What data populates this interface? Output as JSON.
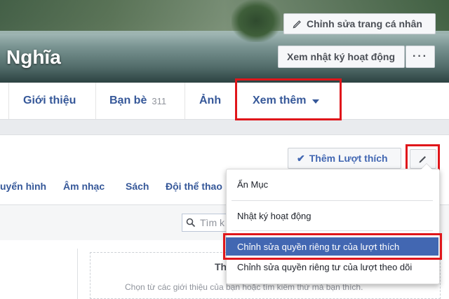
{
  "profile": {
    "name": "Nghĩa"
  },
  "header_buttons": {
    "edit_profile": "Chỉnh sửa trang cá nhân",
    "activity_log": "Xem nhật ký hoạt động",
    "more": "···"
  },
  "nav": {
    "about": "Giới thiệu",
    "friends": "Bạn bè",
    "friends_count": "311",
    "photos": "Ảnh",
    "more": "Xem thêm"
  },
  "likes_panel": {
    "add_likes": "Thêm Lượt thích",
    "subtabs": [
      "uyển hình",
      "Âm nhạc",
      "Sách",
      "Đội thể thao"
    ],
    "search_placeholder": "Tìm k",
    "empty_title": "Th",
    "empty_description": "Chọn từ các giới thiệu của bạn hoặc tìm kiếm thứ mà bạn thích."
  },
  "dropdown": {
    "items": [
      "Ẩn Mục",
      "Nhật ký hoạt động",
      "Chỉnh sửa quyền riêng tư của lượt thích",
      "Chỉnh sửa quyền riêng tư của lượt theo dõi"
    ],
    "active_index": 2
  },
  "colors": {
    "link": "#365899",
    "accent": "#4267b2",
    "highlight": "#e0161b"
  }
}
